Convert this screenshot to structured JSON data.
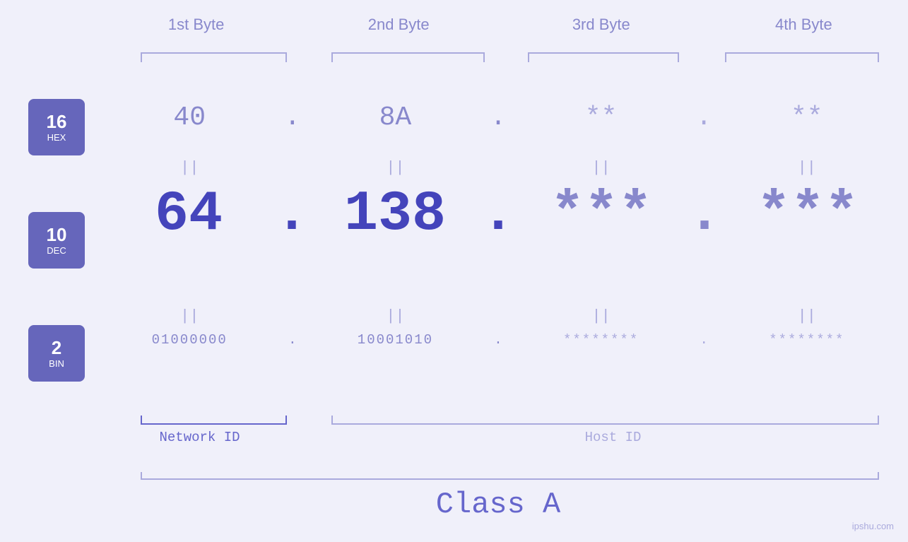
{
  "header": {
    "bytes": [
      "1st Byte",
      "2nd Byte",
      "3rd Byte",
      "4th Byte"
    ]
  },
  "badges": [
    {
      "number": "16",
      "type": "HEX"
    },
    {
      "number": "10",
      "type": "DEC"
    },
    {
      "number": "2",
      "type": "BIN"
    }
  ],
  "hex_row": {
    "values": [
      "40",
      "8A",
      "**",
      "**"
    ],
    "dots": [
      ".",
      ".",
      ".",
      ""
    ]
  },
  "dec_row": {
    "values": [
      "64",
      "138",
      "***",
      "***"
    ],
    "dots": [
      ".",
      ".",
      ".",
      ""
    ]
  },
  "bin_row": {
    "values": [
      "01000000",
      "10001010",
      "********",
      "********"
    ],
    "dots": [
      ".",
      ".",
      ".",
      ""
    ]
  },
  "equals": "||",
  "labels": {
    "network_id": "Network ID",
    "host_id": "Host ID",
    "class": "Class A"
  },
  "watermark": "ipshu.com"
}
